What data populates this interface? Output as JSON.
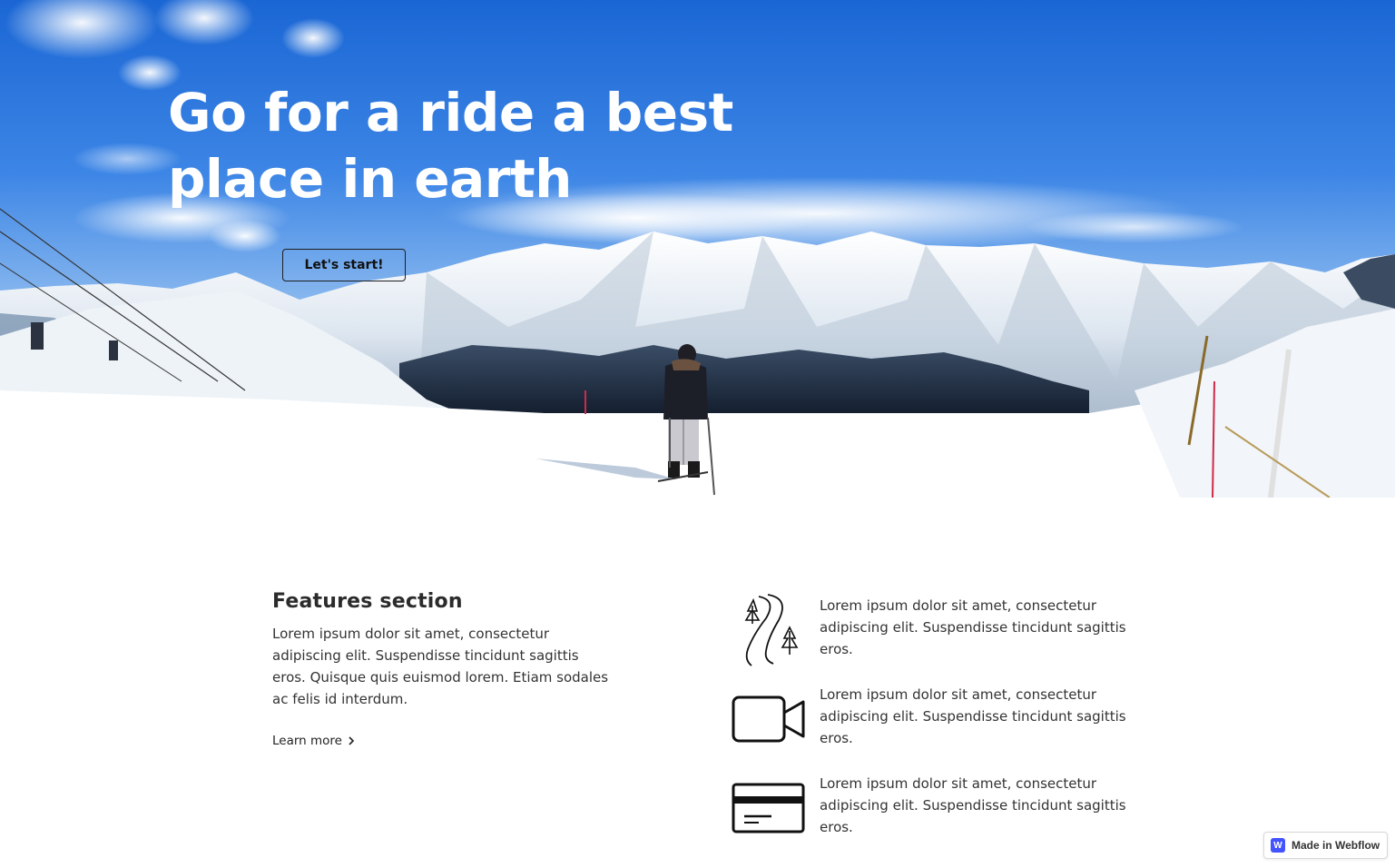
{
  "hero": {
    "title_line1": "Go for a ride a best",
    "title_line2": "place in earth",
    "cta_label": "Let's start!"
  },
  "features": {
    "title": "Features section",
    "description": "Lorem ipsum dolor sit amet, consectetur adipiscing elit. Suspendisse tincidunt sagittis eros. Quisque quis euismod lorem. Etiam sodales ac felis id interdum.",
    "learn_more": "Learn more",
    "items": [
      {
        "icon": "ski-trail-icon",
        "text": "Lorem ipsum dolor sit amet, consectetur adipiscing elit. Suspendisse tincidunt sagittis eros."
      },
      {
        "icon": "video-camera-icon",
        "text": "Lorem ipsum dolor sit amet, consectetur adipiscing elit. Suspendisse tincidunt sagittis eros."
      },
      {
        "icon": "credit-card-icon",
        "text": "Lorem ipsum dolor sit amet, consectetur adipiscing elit. Suspendisse tincidunt sagittis eros."
      }
    ]
  },
  "badge": {
    "logo_letter": "W",
    "label": "Made in Webflow",
    "brand_color": "#4353ff"
  },
  "colors": {
    "sky_top": "#1f6fd8",
    "sky_bottom": "#8fbdf0",
    "snow": "#ffffff",
    "text_dark": "#2b2b2b"
  }
}
